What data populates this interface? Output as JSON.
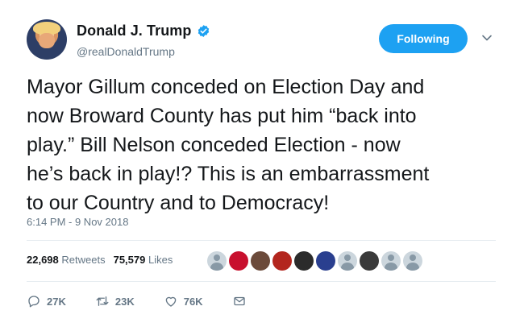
{
  "tweet": {
    "author_name": "Donald J. Trump",
    "handle": "@realDonaldTrump",
    "follow_label": "Following",
    "text": "Mayor Gillum conceded on Election Day and\nnow Broward County has put him “back into\nplay.” Bill Nelson conceded Election - now\nhe’s back in play!? This is an embarrassment\nto our Country and to Democracy!",
    "timestamp": "6:14 PM - 9 Nov 2018"
  },
  "stats": {
    "retweets_count": "22,698",
    "retweets_label": "Retweets",
    "likes_count": "75,579",
    "likes_label": "Likes"
  },
  "likers": [
    {
      "icon": "default-avatar",
      "color": "#ccd6dd"
    },
    {
      "icon": "red-hat-avatar",
      "color": "#c8102e"
    },
    {
      "icon": "person-avatar",
      "color": "#6b4a3a"
    },
    {
      "icon": "red-avatar",
      "color": "#b3261e"
    },
    {
      "icon": "dark-avatar",
      "color": "#2b2b2b"
    },
    {
      "icon": "trump-sign-avatar",
      "color": "#2a3f8f"
    },
    {
      "icon": "default-avatar",
      "color": "#ccd6dd"
    },
    {
      "icon": "group-avatar",
      "color": "#3a3a3a"
    },
    {
      "icon": "default-avatar",
      "color": "#ccd6dd"
    },
    {
      "icon": "default-avatar",
      "color": "#ccd6dd"
    }
  ],
  "actions": {
    "reply_count": "27K",
    "retweet_count": "23K",
    "like_count": "76K"
  },
  "colors": {
    "accent": "#1da1f2",
    "secondary_text": "#657786",
    "divider": "#e6ecf0"
  }
}
